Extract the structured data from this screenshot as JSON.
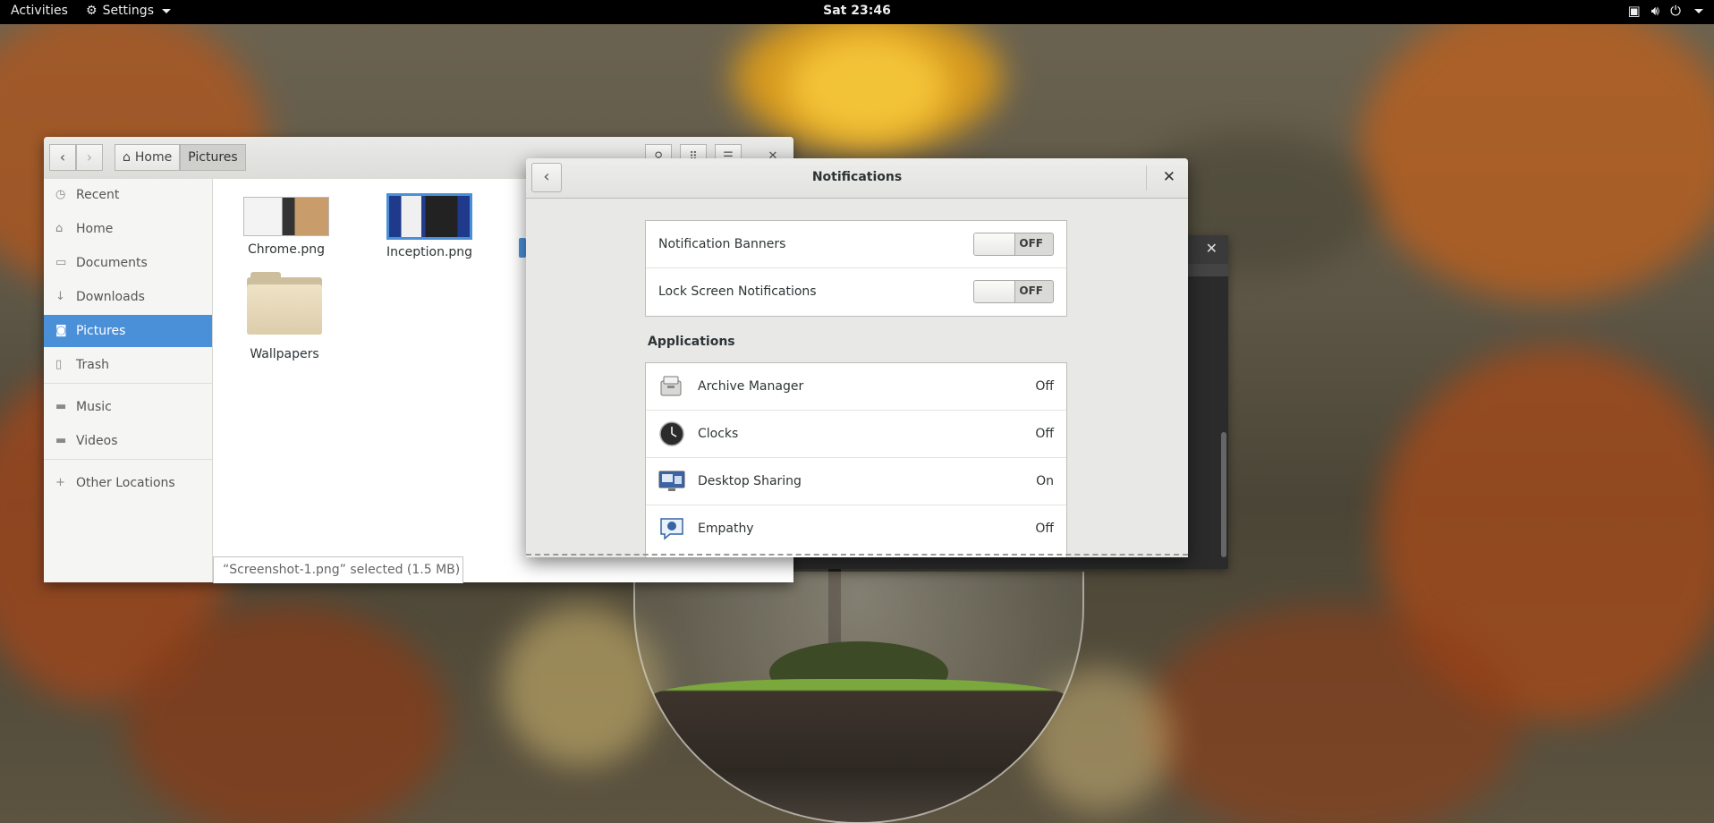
{
  "topbar": {
    "activities": "Activities",
    "app_menu": "Settings",
    "clock": "Sat 23:46"
  },
  "files": {
    "breadcrumbs": [
      "Home",
      "Pictures"
    ],
    "sidebar": [
      {
        "label": "Recent",
        "icon": "clock-icon"
      },
      {
        "label": "Home",
        "icon": "home-icon"
      },
      {
        "label": "Documents",
        "icon": "document-icon"
      },
      {
        "label": "Downloads",
        "icon": "download-icon"
      },
      {
        "label": "Pictures",
        "icon": "camera-icon",
        "selected": true
      },
      {
        "label": "Trash",
        "icon": "trash-icon"
      },
      {
        "label": "Music",
        "icon": "folder-icon"
      },
      {
        "label": "Videos",
        "icon": "folder-icon"
      },
      {
        "label": "Other Locations",
        "icon": "plus-icon"
      }
    ],
    "items": [
      {
        "name": "Chrome.png"
      },
      {
        "name": "Inception.png"
      },
      {
        "name": "Wallpapers"
      }
    ],
    "status": "“Screenshot-1.png” selected  (1.5 MB)"
  },
  "settings": {
    "title": "Notifications",
    "toggles": [
      {
        "label": "Notification Banners",
        "state": "OFF"
      },
      {
        "label": "Lock Screen Notifications",
        "state": "OFF"
      }
    ],
    "applications_title": "Applications",
    "applications": [
      {
        "name": "Archive Manager",
        "status": "Off",
        "icon": "archive-manager-icon"
      },
      {
        "name": "Clocks",
        "status": "Off",
        "icon": "clocks-icon"
      },
      {
        "name": "Desktop Sharing",
        "status": "On",
        "icon": "desktop-sharing-icon"
      },
      {
        "name": "Empathy",
        "status": "Off",
        "icon": "empathy-icon"
      }
    ]
  },
  "colors": {
    "selection": "#4a90d9",
    "topbar": "#000000"
  }
}
